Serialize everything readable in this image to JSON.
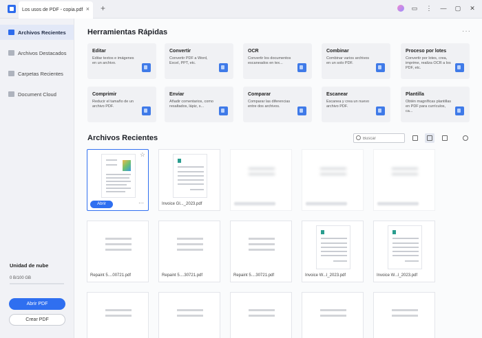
{
  "titlebar": {
    "tab_title": "Los usos de PDF - copia.pdf",
    "tab_close": "×",
    "tab_add": "+",
    "window_controls": {
      "chat": "▭",
      "more": "⋮",
      "minimize": "—",
      "maximize": "▢",
      "close": "✕"
    }
  },
  "sidebar": {
    "items": [
      {
        "label": "Archivos Recientes",
        "icon": "clock-file-icon",
        "active": true
      },
      {
        "label": "Archivos Destacados",
        "icon": "star-file-icon",
        "active": false
      },
      {
        "label": "Carpetas Recientes",
        "icon": "folder-icon",
        "active": false
      },
      {
        "label": "Document Cloud",
        "icon": "cloud-icon",
        "active": false
      }
    ],
    "cloud": {
      "title": "Unidad de nube",
      "usage": "0 B/100 GB",
      "usage_fraction": 0
    },
    "open_pdf": "Abrir PDF",
    "create_pdf": "Crear PDF"
  },
  "quick_tools": {
    "title": "Herramientas Rápidas",
    "more": "···",
    "tools": [
      {
        "name": "Editar",
        "desc": "Editar textos e imágenes en un archivo."
      },
      {
        "name": "Convertir",
        "desc": "Convertir PDF a Word, Excel, PPT, etc."
      },
      {
        "name": "OCR",
        "desc": "Convertir los documentos escaneados en tex..."
      },
      {
        "name": "Combinar",
        "desc": "Combinar varios archivos en un solo PDF."
      },
      {
        "name": "Proceso por lotes",
        "desc": "Convertir por lotes, crea, imprime, realiza OCR a los PDF, etc."
      },
      {
        "name": "Comprimir",
        "desc": "Reducir el tamaño de un archivo PDF."
      },
      {
        "name": "Enviar",
        "desc": "Añadir comentarios, como resaltados, lápiz, s..."
      },
      {
        "name": "Comparar",
        "desc": "Comparar las diferencias entre dos archivos."
      },
      {
        "name": "Escanear",
        "desc": "Escanea y crea un nuevo archivo PDF."
      },
      {
        "name": "Plantilla",
        "desc": "Obtén magníficas plantillas en PDF para currículos, ca..."
      }
    ]
  },
  "recent": {
    "title": "Archivos Recientes",
    "search_placeholder": "Buscar",
    "open_label": "Abrir",
    "card_more": "···",
    "files": [
      {
        "name": "",
        "kind": "flyer"
      },
      {
        "name": "Invoice Gl..._2023.pdf",
        "kind": "invoice"
      },
      {
        "name": "",
        "kind": "blur"
      },
      {
        "name": "",
        "kind": "blur"
      },
      {
        "name": "",
        "kind": "blur"
      },
      {
        "name": "Repaint 5....00721.pdf",
        "kind": "plain"
      },
      {
        "name": "Repaint 5....30721.pdf",
        "kind": "plain"
      },
      {
        "name": "Repaint 5....30721.pdf",
        "kind": "plain"
      },
      {
        "name": "Invoice W...l_2023.pdf",
        "kind": "invoice"
      },
      {
        "name": "Invoice W...l_2023.pdf",
        "kind": "invoice"
      },
      {
        "name": "",
        "kind": "plain"
      },
      {
        "name": "",
        "kind": "plain"
      },
      {
        "name": "",
        "kind": "plain"
      },
      {
        "name": "",
        "kind": "plain"
      },
      {
        "name": "",
        "kind": "plain"
      }
    ]
  }
}
